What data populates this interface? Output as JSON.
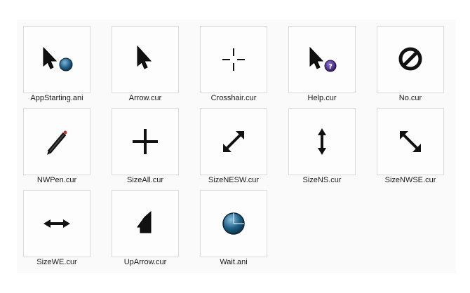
{
  "files": [
    {
      "name": "AppStarting.ani",
      "icon": "app-starting-cursor-icon"
    },
    {
      "name": "Arrow.cur",
      "icon": "arrow-cursor-icon"
    },
    {
      "name": "Crosshair.cur",
      "icon": "crosshair-cursor-icon"
    },
    {
      "name": "Help.cur",
      "icon": "help-cursor-icon"
    },
    {
      "name": "No.cur",
      "icon": "no-cursor-icon"
    },
    {
      "name": "NWPen.cur",
      "icon": "pen-cursor-icon"
    },
    {
      "name": "SizeAll.cur",
      "icon": "size-all-cursor-icon"
    },
    {
      "name": "SizeNESW.cur",
      "icon": "size-nesw-cursor-icon"
    },
    {
      "name": "SizeNS.cur",
      "icon": "size-ns-cursor-icon"
    },
    {
      "name": "SizeNWSE.cur",
      "icon": "size-nwse-cursor-icon"
    },
    {
      "name": "SizeWE.cur",
      "icon": "size-we-cursor-icon"
    },
    {
      "name": "UpArrow.cur",
      "icon": "up-arrow-cursor-icon"
    },
    {
      "name": "Wait.ani",
      "icon": "wait-cursor-icon"
    }
  ],
  "colors": {
    "cursor_fill": "#111111",
    "busy_blue": "#1f5f86",
    "help_purple": "#4a2f8a",
    "pen_tip": "#c0392b"
  }
}
